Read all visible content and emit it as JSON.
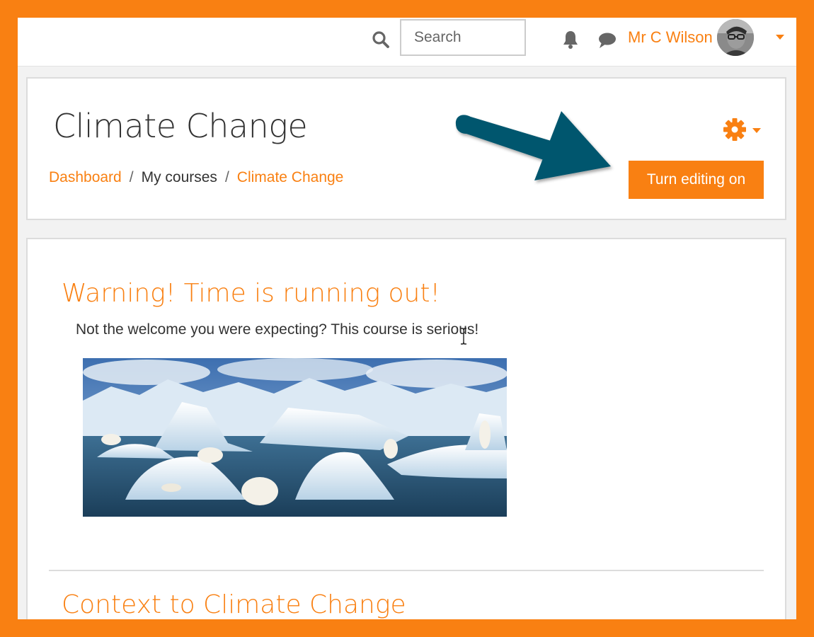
{
  "navbar": {
    "search_placeholder": "Search",
    "user_name": "Mr C Wilson",
    "icons": [
      "search-icon",
      "bell-icon",
      "chat-icon",
      "chevron-down-icon"
    ]
  },
  "header": {
    "title": "Climate Change",
    "breadcrumb": [
      {
        "label": "Dashboard",
        "link": true
      },
      {
        "label": "My courses",
        "link": false
      },
      {
        "label": "Climate Change",
        "link": true
      }
    ],
    "separator": "/",
    "editing_button": "Turn editing on"
  },
  "content": {
    "section1_title": "Warning! Time is running out!",
    "section1_text": "Not the welcome you were expecting? This course is serious!",
    "section2_title": "Context to Climate Change"
  },
  "colors": {
    "accent": "#f98012",
    "arrow": "#00566e",
    "text": "#333333",
    "border": "#dcdcdc"
  }
}
